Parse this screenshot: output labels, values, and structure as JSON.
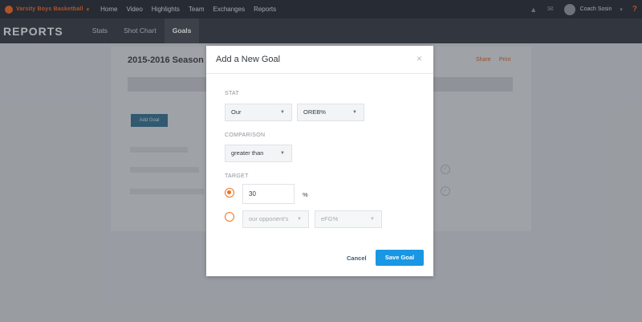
{
  "topnav": {
    "team_name": "Varsity Boys Basketball",
    "links": [
      "Home",
      "Video",
      "Highlights",
      "Team",
      "Exchanges",
      "Reports"
    ],
    "user_name": "Coach Sosin",
    "help": "?"
  },
  "subnav": {
    "title": "REPORTS",
    "tabs": [
      "Stats",
      "Shot Chart",
      "Goals"
    ],
    "active_tab": "Goals"
  },
  "content": {
    "season_title": "2015-2016 Season",
    "share": "Share",
    "print": "Print",
    "add_goal": "Add Goal"
  },
  "modal": {
    "title": "Add a New Goal",
    "close": "×",
    "stat_label": "STAT",
    "stat_owner": "Our",
    "stat_name": "OREB%",
    "comparison_label": "COMPARISON",
    "comparison": "greater than",
    "target_label": "TARGET",
    "target_value": "30",
    "target_unit": "%",
    "opponent_select": "our opponent's",
    "opponent_stat": "eFG%",
    "cancel": "Cancel",
    "save": "Save Goal"
  },
  "colors": {
    "accent_orange": "#f07322",
    "primary_blue": "#1997e3"
  }
}
